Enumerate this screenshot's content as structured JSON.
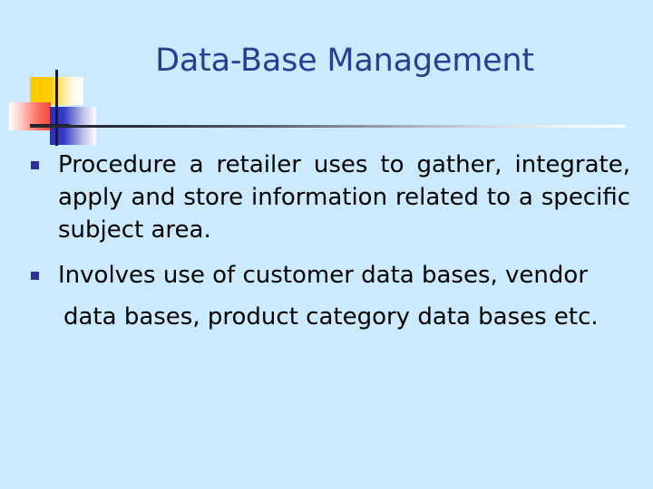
{
  "slide": {
    "background_color": "#cbeafd",
    "title": "Data-Base Management",
    "title_color": "#2c3c90",
    "divider_color_start": "#23262e",
    "divider_color_end": "#ffffff"
  },
  "decoration": {
    "name": "blends-design-motif",
    "yellow_color": "#ffcc00",
    "red_color": "#f4473a",
    "blue_color": "#2b2fbb",
    "crosshair_color": "#1a1a24"
  },
  "body": {
    "bullet_marker_color": "#2e3192",
    "text_color": "#000000",
    "bullets": [
      {
        "marker": "square-bullet",
        "text": "Procedure a retailer uses to gather, integrate, apply and store information related to a specific subject area.",
        "line_1": "Procedure a retailer uses to gather,",
        "line_2": "integrate, apply and store information",
        "line_3": "related to a specific subject area."
      },
      {
        "marker": "square-bullet",
        "line_1": "Involves use of customer data bases, vendor",
        "line_2": "data bases, product category data bases etc."
      }
    ]
  }
}
